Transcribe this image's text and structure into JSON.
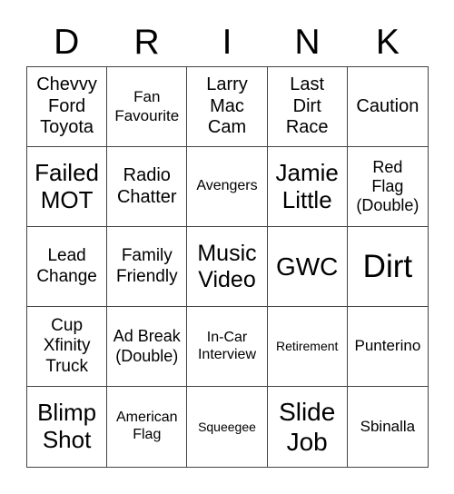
{
  "header": {
    "letters": [
      "D",
      "R",
      "I",
      "N",
      "K"
    ]
  },
  "cells": [
    [
      "Chevvy Ford Toyota",
      "Fan Favourite",
      "Larry Mac Cam",
      "Last Dirt Race",
      "Caution"
    ],
    [
      "Failed MOT",
      "Radio Chatter",
      "Avengers",
      "Jamie Little",
      "Red Flag (Double)"
    ],
    [
      "Lead Change",
      "Family Friendly",
      "Music Video",
      "GWC",
      "Dirt"
    ],
    [
      "Cup Xfinity Truck",
      "Ad Break (Double)",
      "In-Car Interview",
      "Retirement",
      "Punterino"
    ],
    [
      "Blimp Shot",
      "American Flag",
      "Squeegee",
      "Slide Job",
      "Sbinalla"
    ]
  ]
}
